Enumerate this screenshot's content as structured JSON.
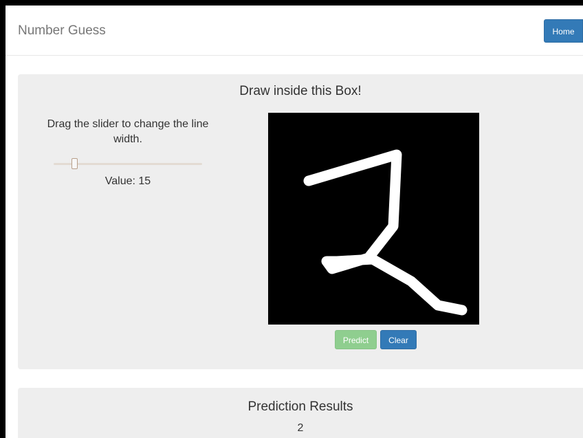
{
  "navbar": {
    "brand": "Number Guess",
    "home_label": "Home"
  },
  "draw_panel": {
    "title": "Draw inside this Box!",
    "slider_instruction": "Drag the slider to change the line width.",
    "slider_value_text": "Value: 15",
    "line_width": 15,
    "predict_label": "Predict",
    "clear_label": "Clear",
    "canvas_bg": "#000000",
    "stroke_color": "#ffffff",
    "predict_color": "#8fce8f",
    "clear_color": "#337ab7"
  },
  "results_panel": {
    "title": "Prediction Results",
    "prediction": "2"
  }
}
